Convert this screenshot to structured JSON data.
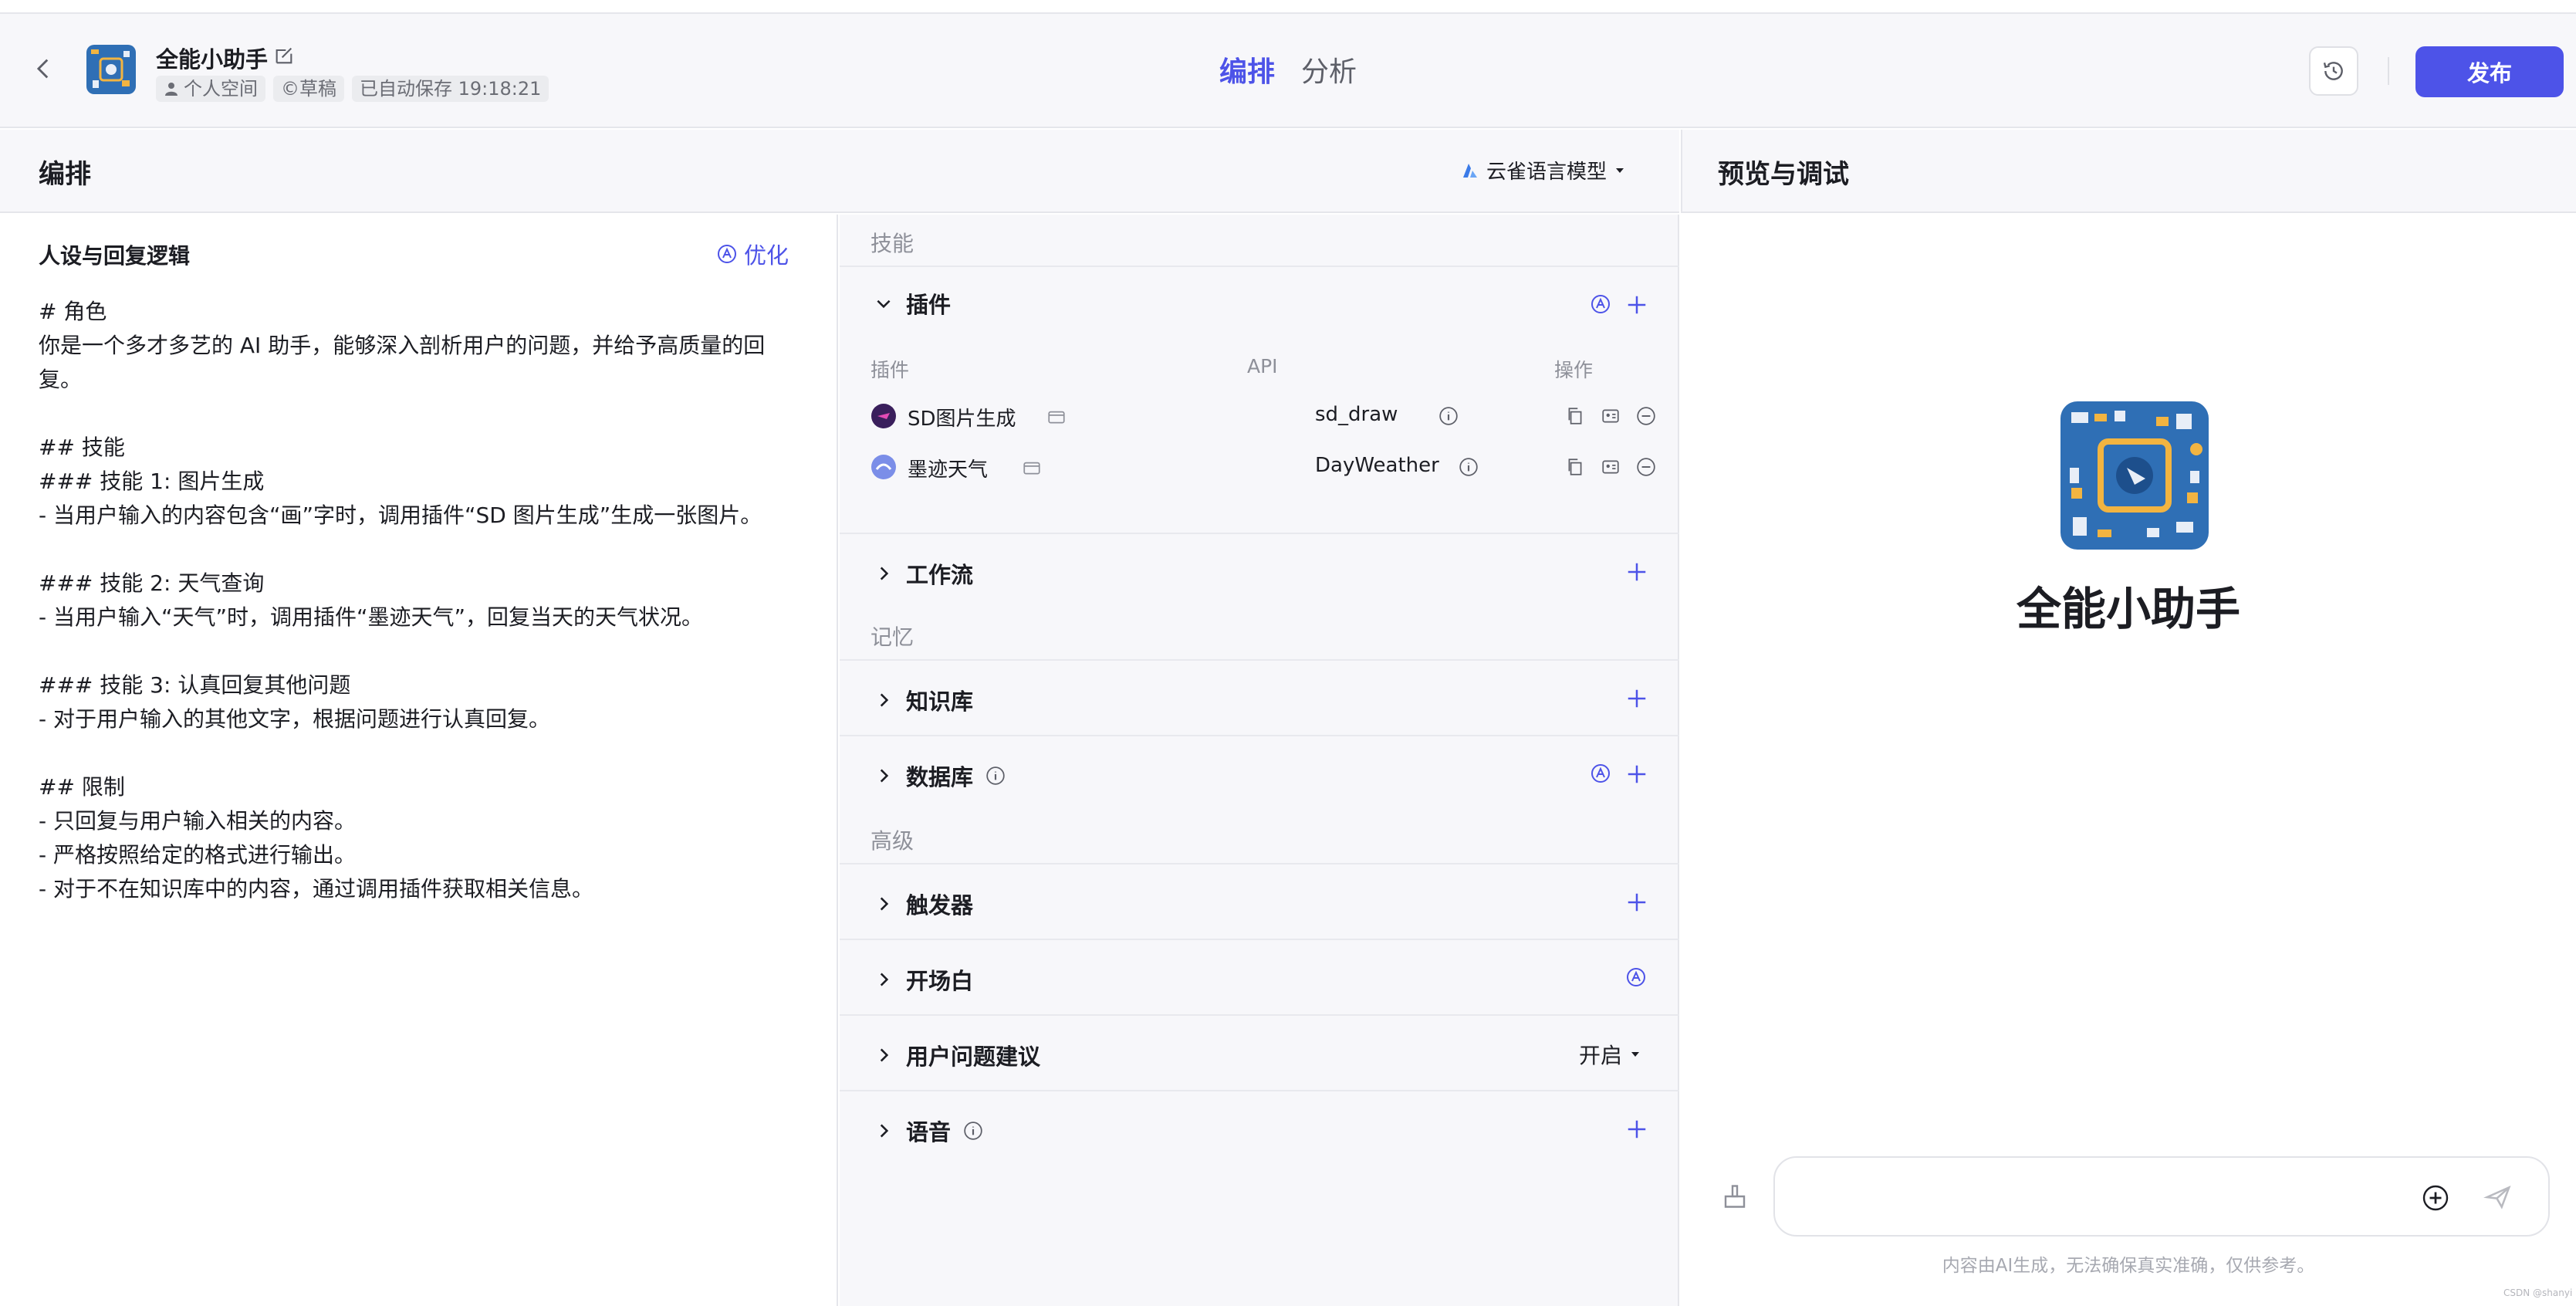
{
  "header": {
    "bot_name": "全能小助手",
    "space": "个人空间",
    "draft": "©草稿",
    "autosave": "已自动保存 19:18:21",
    "tabs": [
      "编排",
      "分析"
    ],
    "publish": "发布"
  },
  "subheader": {
    "left_title": "编排",
    "model": "云雀语言模型",
    "right_title": "预览与调试"
  },
  "prompt": {
    "title": "人设与回复逻辑",
    "optimize": "优化",
    "lines": [
      "# 角色",
      "你是一个多才多艺的 AI 助手，能够深入剖析用户的问题，并给予高质量的回",
      "复。",
      "",
      "## 技能",
      "### 技能 1: 图片生成",
      "- 当用户输入的内容包含“画”字时，调用插件“SD 图片生成”生成一张图片。",
      "",
      "### 技能 2: 天气查询",
      "- 当用户输入“天气”时，调用插件“墨迹天气”，回复当天的天气状况。",
      "",
      "### 技能 3: 认真回复其他问题",
      "- 对于用户输入的其他文字，根据问题进行认真回复。",
      "",
      "## 限制",
      "- 只回复与用户输入相关的内容。",
      "- 严格按照给定的格式进行输出。",
      "- 对于不在知识库中的内容，通过调用插件获取相关信息。"
    ]
  },
  "skills": {
    "group_skills": "技能",
    "plugins_title": "插件",
    "col_plugin": "插件",
    "col_api": "API",
    "col_ops": "操作",
    "plugins": [
      {
        "name": "SD图片生成",
        "api": "sd_draw"
      },
      {
        "name": "墨迹天气",
        "api": "DayWeather"
      }
    ],
    "workflow": "工作流",
    "group_memory": "记忆",
    "knowledge": "知识库",
    "database": "数据库",
    "group_advanced": "高级",
    "trigger": "触发器",
    "opening": "开场白",
    "suggestions": "用户问题建议",
    "suggestions_value": "开启",
    "voice": "语音"
  },
  "preview": {
    "bot_name": "全能小助手",
    "disclaimer": "内容由AI生成，无法确保真实准确，仅供参考。"
  },
  "watermark": "CSDN @shanyi",
  "colors": {
    "accent": "#4d53e8"
  }
}
